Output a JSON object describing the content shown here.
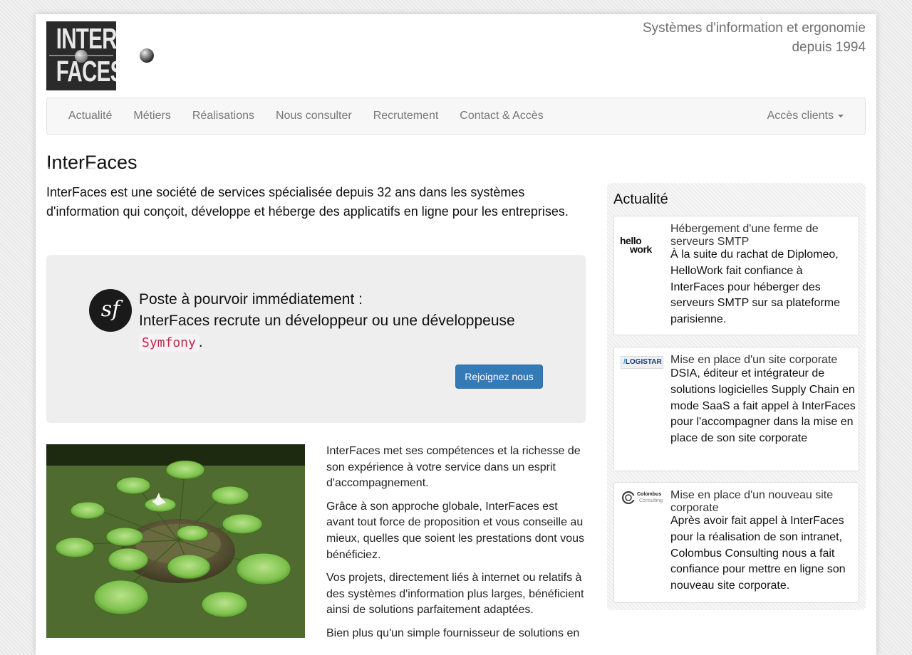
{
  "header": {
    "logo_line1": "INTER",
    "logo_line2": "FACES",
    "tagline_line1": "Systèmes d'information et ergonomie",
    "tagline_line2": "depuis 1994"
  },
  "nav": {
    "items": [
      "Actualité",
      "Métiers",
      "Réalisations",
      "Nous consulter",
      "Recrutement",
      "Contact & Accès"
    ],
    "clients_label": "Accès clients"
  },
  "main": {
    "title": "InterFaces",
    "intro": "InterFaces est une société de services spécialisée depuis 32 ans dans les systèmes d'information qui conçoit, développe et héberge des applicatifs en ligne pour les entreprises.",
    "job": {
      "line1": "Poste à pourvoir immédiatement :",
      "line2": "InterFaces recrute un développeur ou une développeuse",
      "tech": "Symfony",
      "end": ".",
      "button": "Rejoignez nous",
      "logo_glyph": "sf"
    },
    "paragraphs": [
      "InterFaces met ses compétences et la richesse de son expérience à votre service dans un esprit d'accompagnement.",
      "Grâce à son approche globale, InterFaces est avant tout force de proposition et vous conseille au mieux, quelles que soient les prestations dont vous bénéficiez.",
      "Vos projets, directement liés à internet ou relatifs à des systèmes d'information plus larges, bénéficient ainsi de solutions parfaitement adaptées.",
      "Bien plus qu'un simple fournisseur de solutions en"
    ]
  },
  "sidebar": {
    "title": "Actualité",
    "news": [
      {
        "logo": "hellowork",
        "logo_text_top": "hello",
        "logo_text_bottom": "work",
        "title": "Hébergement d'une ferme de serveurs SMTP",
        "body": "À la suite du rachat de Diplomeo, HelloWork fait confiance à InterFaces pour héberger des serveurs SMTP sur sa plateforme parisienne."
      },
      {
        "logo": "logistar",
        "logo_text": "LOGISTAR",
        "title": "Mise en place d'un site corporate",
        "body": "DSIA, éditeur et intégrateur de solutions logicielles Supply Chain en mode SaaS a fait appel à InterFaces pour l'accompagner dans la mise en place de son site corporate"
      },
      {
        "logo": "colombus",
        "logo_text_top": "Colombus",
        "logo_text_bottom": "Consulting",
        "title": "Mise en place d'un nouveau site corporate",
        "body": "Après avoir fait appel à InterFaces pour la réalisation de son intranet, Colombus Consulting nous a fait confiance pour mettre en ligne son nouveau site corporate."
      }
    ]
  },
  "colors": {
    "primary_button": "#337ab7",
    "nav_text": "#777777",
    "code_text": "#c7254e"
  }
}
